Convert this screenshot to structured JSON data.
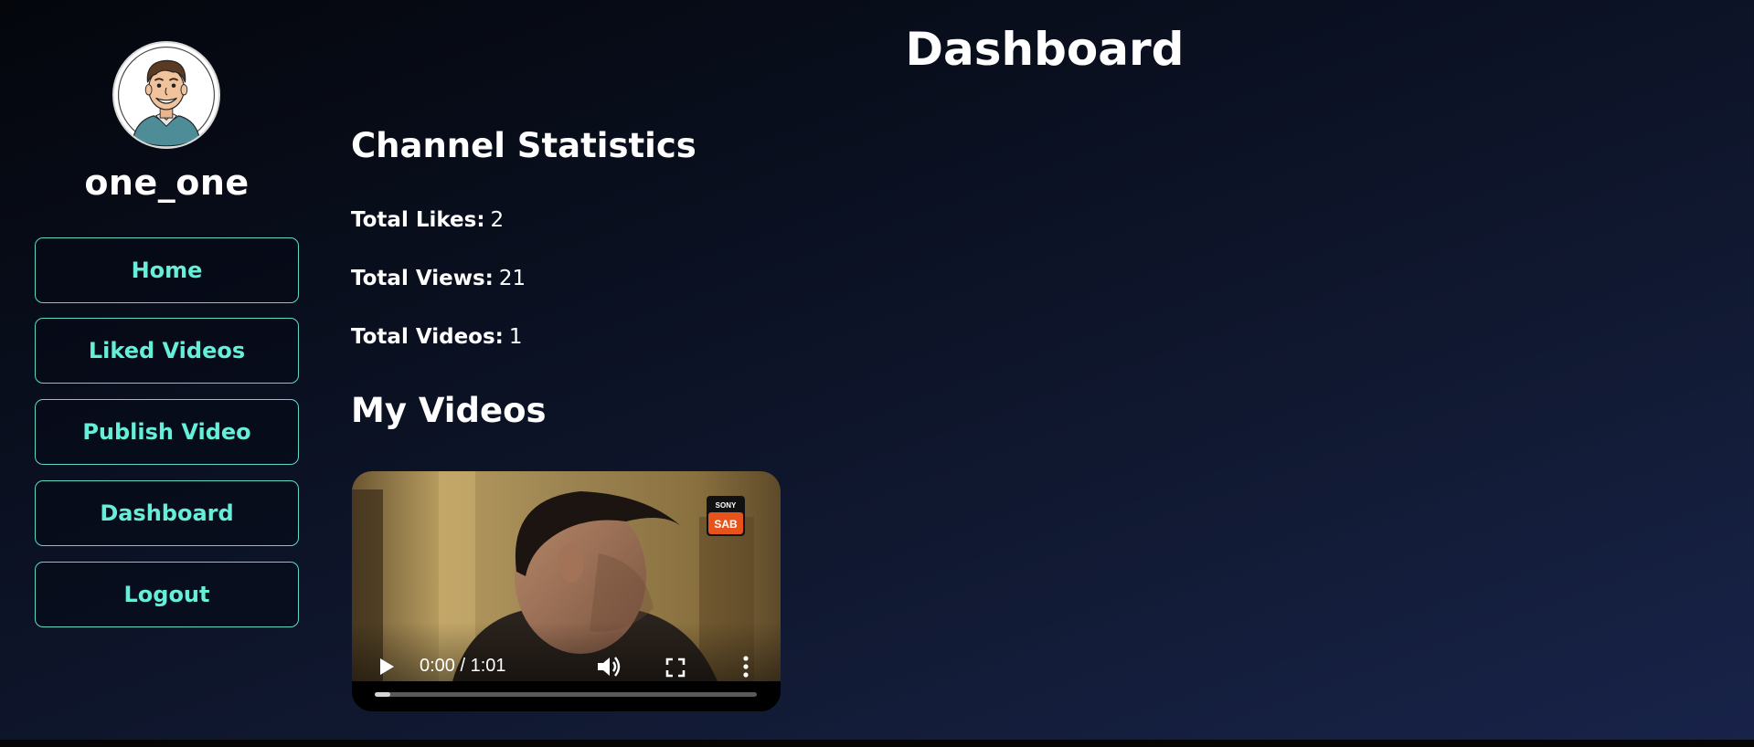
{
  "sidebar": {
    "username": "one_one",
    "nav": [
      {
        "label": "Home"
      },
      {
        "label": "Liked Videos"
      },
      {
        "label": "Publish Video"
      },
      {
        "label": "Dashboard"
      },
      {
        "label": "Logout"
      }
    ]
  },
  "main": {
    "title": "Dashboard",
    "stats_heading": "Channel Statistics",
    "stats": [
      {
        "label": "Total Likes:",
        "value": "2"
      },
      {
        "label": "Total Views:",
        "value": "21"
      },
      {
        "label": "Total Videos:",
        "value": "1"
      }
    ],
    "videos_heading": "My Videos",
    "video": {
      "time": "0:00 / 1:01",
      "progress": 0,
      "buffered": 0.04,
      "watermark_top": "SONY",
      "watermark_bottom": "SAB"
    }
  },
  "colors": {
    "accent": "#66efd8",
    "border": "#5fd9c6",
    "text": "#ffffff"
  },
  "icons": {
    "avatar": "cartoon-man-avatar",
    "play": "play-icon",
    "volume": "volume-icon",
    "fullscreen": "fullscreen-icon",
    "more": "more-vertical-icon"
  }
}
